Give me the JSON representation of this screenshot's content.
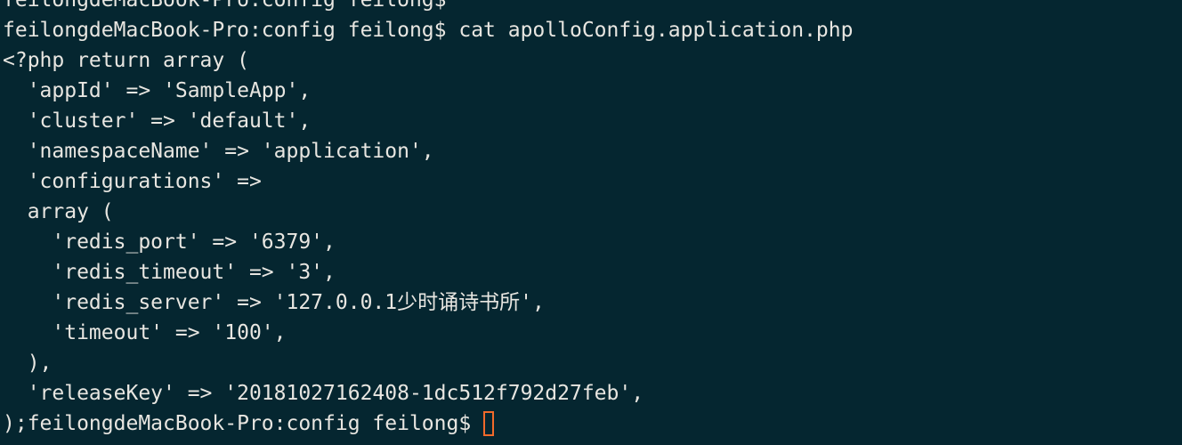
{
  "terminal": {
    "lines": [
      "feilongdeMacBook-Pro:config feilong$",
      "feilongdeMacBook-Pro:config feilong$ cat apolloConfig.application.php",
      "<?php return array (",
      "  'appId' => 'SampleApp',",
      "  'cluster' => 'default',",
      "  'namespaceName' => 'application',",
      "  'configurations' =>",
      "  array (",
      "    'redis_port' => '6379',",
      "    'redis_timeout' => '3',",
      "    'redis_server' => '127.0.0.1少时诵诗书所',",
      "    'timeout' => '100',",
      "  ),",
      "  'releaseKey' => '20181027162408-1dc512f792d27feb',",
      ");feilongdeMacBook-Pro:config feilong$"
    ],
    "cursor_color": "#f26a2a",
    "background_color": "#052630",
    "text_color": "#e8e6e1"
  }
}
